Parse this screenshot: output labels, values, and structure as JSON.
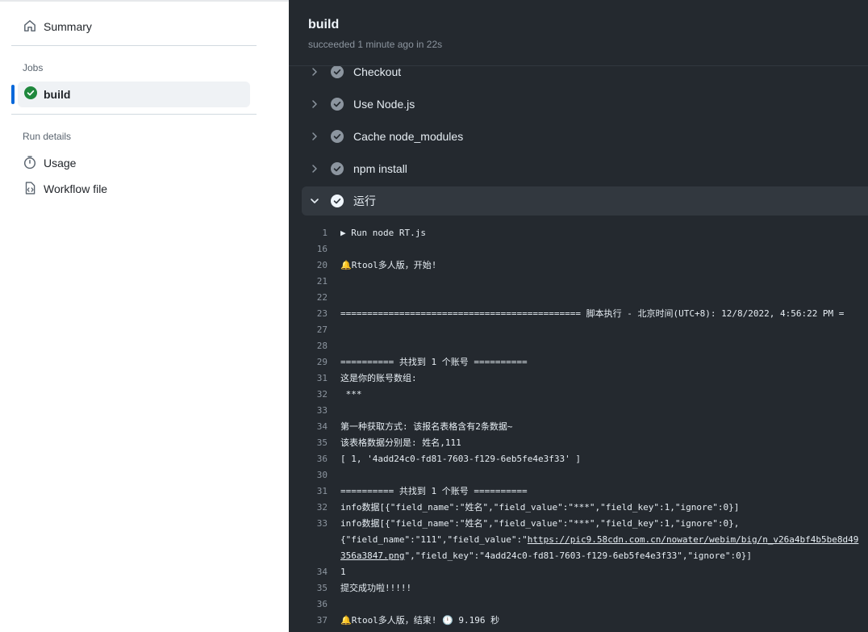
{
  "sidebar": {
    "summary_label": "Summary",
    "jobs_heading": "Jobs",
    "job": {
      "label": "build",
      "status": "success"
    },
    "run_details_heading": "Run details",
    "usage_label": "Usage",
    "workflow_file_label": "Workflow file"
  },
  "header": {
    "title": "build",
    "subtitle": "succeeded 1 minute ago in 22s"
  },
  "steps": [
    {
      "label": "Checkout",
      "expanded": false
    },
    {
      "label": "Use Node.js",
      "expanded": false
    },
    {
      "label": "Cache node_modules",
      "expanded": false
    },
    {
      "label": "npm install",
      "expanded": false
    },
    {
      "label": "运行",
      "expanded": true
    }
  ],
  "log": [
    {
      "n": "1",
      "text": "▶ Run node RT.js"
    },
    {
      "n": "16",
      "text": ""
    },
    {
      "n": "20",
      "text": "🔔Rtool多人版，开始!"
    },
    {
      "n": "21",
      "text": ""
    },
    {
      "n": "22",
      "text": ""
    },
    {
      "n": "23",
      "text": "============================================= 脚本执行 - 北京时间(UTC+8): 12/8/2022, 4:56:22 PM ="
    },
    {
      "n": "27",
      "text": ""
    },
    {
      "n": "28",
      "text": ""
    },
    {
      "n": "29",
      "text": "========== 共找到 1 个账号 =========="
    },
    {
      "n": "31",
      "text": "这是你的账号数组:"
    },
    {
      "n": "32",
      "text": " ***"
    },
    {
      "n": "33",
      "text": ""
    },
    {
      "n": "34",
      "text": "第一种获取方式: 该报名表格含有2条数据~"
    },
    {
      "n": "35",
      "text": "该表格数据分别是: 姓名,111"
    },
    {
      "n": "36",
      "text": "[ 1, '4add24c0-fd81-7603-f129-6eb5fe4e3f33' ]"
    },
    {
      "n": "30",
      "text": ""
    },
    {
      "n": "31",
      "text": "========== 共找到 1 个账号 =========="
    },
    {
      "n": "32",
      "text": "info数据[{\"field_name\":\"姓名\",\"field_value\":\"***\",\"field_key\":1,\"ignore\":0}]"
    },
    {
      "n": "33",
      "text": "info数据[{\"field_name\":\"姓名\",\"field_value\":\"***\",\"field_key\":1,\"ignore\":0},"
    },
    {
      "n": "",
      "text": "{\"field_name\":\"111\",\"field_value\":\"",
      "link": "https://pic9.58cdn.com.cn/nowater/webim/big/n_v26a4bf4b5be8d49"
    },
    {
      "n": "",
      "link": "356a3847.png",
      "text": "\",\"field_key\":\"4add24c0-fd81-7603-f129-6eb5fe4e3f33\",\"ignore\":0}]"
    },
    {
      "n": "34",
      "text": "1"
    },
    {
      "n": "35",
      "text": "提交成功啦!!!!!"
    },
    {
      "n": "36",
      "text": ""
    },
    {
      "n": "37",
      "text": "🔔Rtool多人版，结束! 🕛 9.196 秒"
    }
  ]
}
